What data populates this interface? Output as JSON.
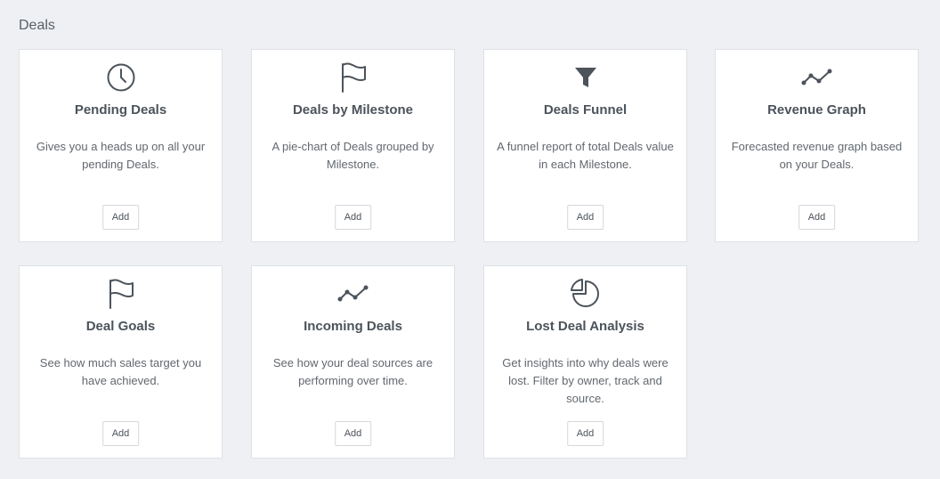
{
  "section": {
    "title": "Deals"
  },
  "cards": [
    {
      "icon": "clock-icon",
      "title": "Pending Deals",
      "description": "Gives you a heads up on all your pending Deals.",
      "button": "Add"
    },
    {
      "icon": "flag-icon",
      "title": "Deals by Milestone",
      "description": "A pie-chart of Deals grouped by Milestone.",
      "button": "Add"
    },
    {
      "icon": "funnel-icon",
      "title": "Deals Funnel",
      "description": "A funnel report of total Deals value in each Milestone.",
      "button": "Add"
    },
    {
      "icon": "line-graph-icon",
      "title": "Revenue Graph",
      "description": "Forecasted revenue graph based on your Deals.",
      "button": "Add"
    },
    {
      "icon": "flag-icon",
      "title": "Deal Goals",
      "description": "See how much sales target you have achieved.",
      "button": "Add"
    },
    {
      "icon": "line-graph-icon",
      "title": "Incoming Deals",
      "description": "See how your deal sources are performing over time.",
      "button": "Add"
    },
    {
      "icon": "pie-chart-icon",
      "title": "Lost Deal Analysis",
      "description": "Get insights into why deals were lost. Filter by owner, track and source.",
      "button": "Add"
    }
  ]
}
